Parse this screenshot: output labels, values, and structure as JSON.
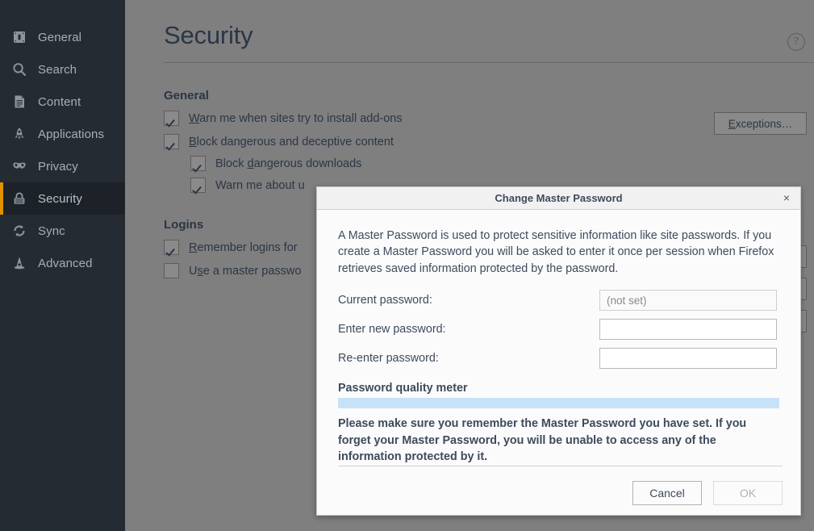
{
  "sidebar": {
    "items": [
      {
        "label": "General",
        "icon": "panel-icon",
        "selected": false
      },
      {
        "label": "Search",
        "icon": "search-icon",
        "selected": false
      },
      {
        "label": "Content",
        "icon": "document-icon",
        "selected": false
      },
      {
        "label": "Applications",
        "icon": "rocket-icon",
        "selected": false
      },
      {
        "label": "Privacy",
        "icon": "mask-icon",
        "selected": false
      },
      {
        "label": "Security",
        "icon": "padlock-icon",
        "selected": true
      },
      {
        "label": "Sync",
        "icon": "sync-arrows-icon",
        "selected": false
      },
      {
        "label": "Advanced",
        "icon": "wizard-hat-icon",
        "selected": false
      }
    ],
    "accent_color": "#e09200",
    "background_color": "#252b33",
    "selected_background": "#1d2228"
  },
  "main": {
    "page_title": "Security",
    "help_icon_glyph": "?",
    "general": {
      "heading": "General",
      "rows": [
        {
          "label_prefix": "",
          "accesskey": "W",
          "label_rest": "arn me when sites try to install add-ons",
          "checked": true,
          "indent": false
        },
        {
          "label_prefix": "",
          "accesskey": "B",
          "label_rest": "lock dangerous and deceptive content",
          "checked": true,
          "indent": false
        },
        {
          "label_prefix": "Block ",
          "accesskey": "d",
          "label_rest": "angerous downloads",
          "checked": true,
          "indent": true
        },
        {
          "label_prefix": "Warn me about u",
          "accesskey": "",
          "label_rest": "",
          "checked": true,
          "indent": true
        }
      ],
      "exceptions_button": {
        "label_prefix": "",
        "accesskey": "E",
        "label_rest": "xceptions…"
      }
    },
    "logins": {
      "heading": "Logins",
      "rows": [
        {
          "label_prefix": "",
          "accesskey": "R",
          "label_rest": "emember logins for",
          "checked": true,
          "indent": false
        },
        {
          "label_prefix": "U",
          "accesskey": "s",
          "label_rest": "e a master passwo",
          "checked": false,
          "indent": false
        }
      ]
    }
  },
  "dialog": {
    "title": "Change Master Password",
    "close_glyph": "×",
    "intro": "A Master Password is used to protect sensitive information like site passwords. If you create a Master Password you will be asked to enter it once per session when Firefox retrieves saved information protected by the password.",
    "fields": [
      {
        "label": "Current password:",
        "value": "(not set)",
        "placeholder": "",
        "disabled": true
      },
      {
        "label": "Enter new password:",
        "value": "",
        "placeholder": "",
        "disabled": false
      },
      {
        "label": "Re-enter password:",
        "value": "",
        "placeholder": "",
        "disabled": false
      }
    ],
    "meter": {
      "label": "Password quality meter",
      "value": 0,
      "track_color": "#c7e2f7"
    },
    "warning": "Please make sure you remember the Master Password you have set. If you forget your Master Password, you will be unable to access any of the information protected by it.",
    "buttons": [
      {
        "label": "Cancel",
        "disabled": false
      },
      {
        "label": "OK",
        "disabled": true
      }
    ]
  }
}
